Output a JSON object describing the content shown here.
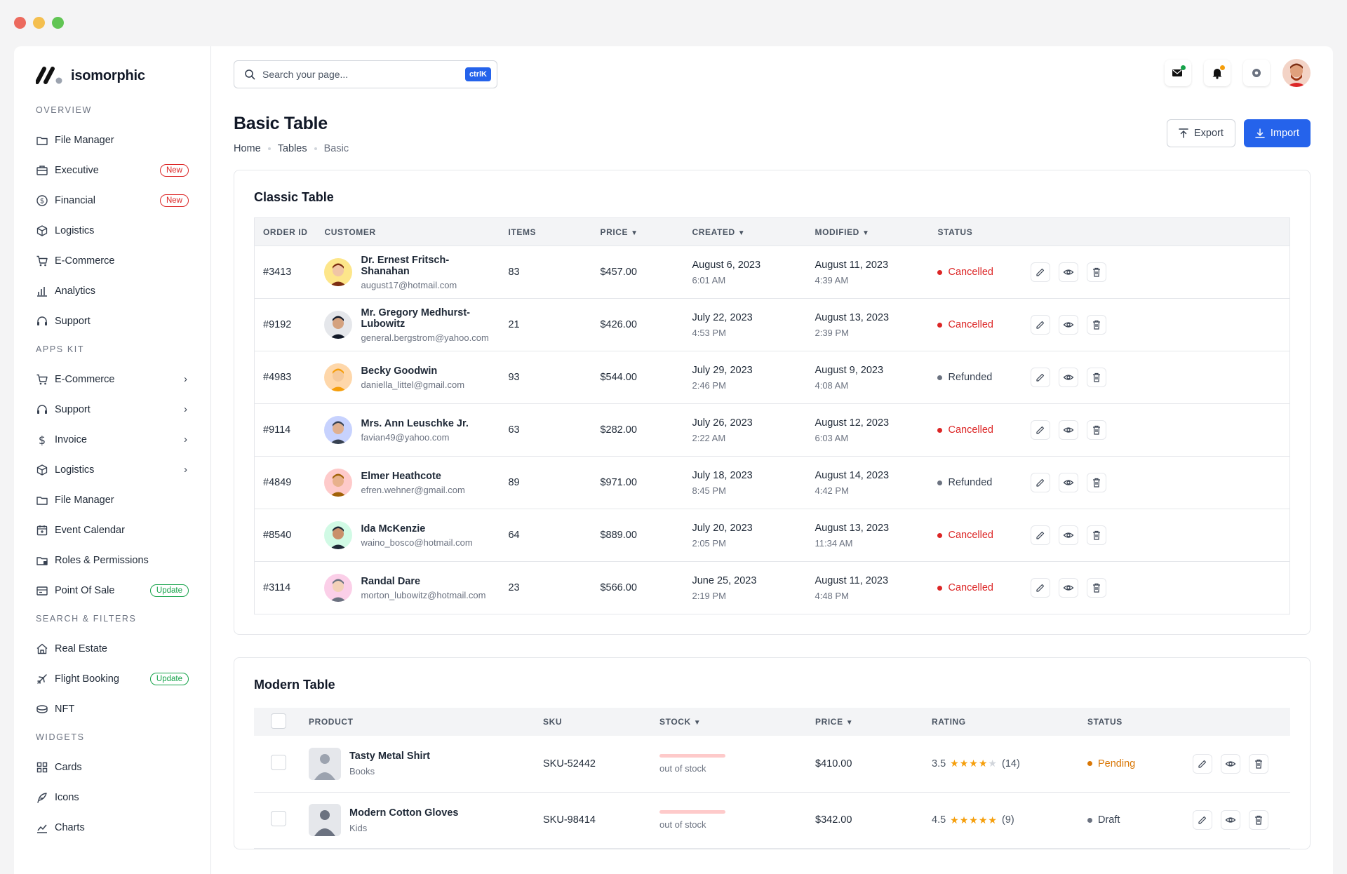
{
  "window_controls": {
    "colors": [
      "#ec6a5e",
      "#f4bf4f",
      "#61c554"
    ]
  },
  "brand": {
    "name": "isomorphic"
  },
  "sidebar": {
    "sections": [
      {
        "title": "OVERVIEW",
        "items": [
          {
            "label": "File Manager",
            "icon": "folder-icon"
          },
          {
            "label": "Executive",
            "icon": "briefcase-icon",
            "badge": "New",
            "badge_type": "new"
          },
          {
            "label": "Financial",
            "icon": "dollar-circle-icon",
            "badge": "New",
            "badge_type": "new"
          },
          {
            "label": "Logistics",
            "icon": "package-icon"
          },
          {
            "label": "E-Commerce",
            "icon": "cart-icon"
          },
          {
            "label": "Analytics",
            "icon": "bar-chart-icon"
          },
          {
            "label": "Support",
            "icon": "headset-icon"
          }
        ]
      },
      {
        "title": "APPS KIT",
        "items": [
          {
            "label": "E-Commerce",
            "icon": "cart-icon",
            "chevron": true
          },
          {
            "label": "Support",
            "icon": "headset-icon",
            "chevron": true
          },
          {
            "label": "Invoice",
            "icon": "dollar-icon",
            "chevron": true
          },
          {
            "label": "Logistics",
            "icon": "package-icon",
            "chevron": true
          },
          {
            "label": "File Manager",
            "icon": "folder-icon"
          },
          {
            "label": "Event Calendar",
            "icon": "calendar-icon"
          },
          {
            "label": "Roles & Permissions",
            "icon": "folder-lock-icon"
          },
          {
            "label": "Point Of Sale",
            "icon": "pos-icon",
            "badge": "Update",
            "badge_type": "upd"
          }
        ]
      },
      {
        "title": "SEARCH & FILTERS",
        "items": [
          {
            "label": "Real Estate",
            "icon": "house-icon"
          },
          {
            "label": "Flight Booking",
            "icon": "plane-icon",
            "badge": "Update",
            "badge_type": "upd"
          },
          {
            "label": "NFT",
            "icon": "coins-icon"
          }
        ]
      },
      {
        "title": "WIDGETS",
        "items": [
          {
            "label": "Cards",
            "icon": "grid-icon"
          },
          {
            "label": "Icons",
            "icon": "feather-icon"
          },
          {
            "label": "Charts",
            "icon": "line-chart-icon"
          }
        ]
      }
    ]
  },
  "search": {
    "placeholder": "Search your page...",
    "shortcut": "ctrlK"
  },
  "header": {
    "notification_dot_colors": [
      "#16a34a",
      "#f59e0b"
    ]
  },
  "page": {
    "title": "Basic Table",
    "breadcrumbs": [
      "Home",
      "Tables",
      "Basic"
    ],
    "export_label": "Export",
    "import_label": "Import"
  },
  "classic_table": {
    "title": "Classic Table",
    "columns": [
      "ORDER ID",
      "CUSTOMER",
      "ITEMS",
      "PRICE",
      "CREATED",
      "MODIFIED",
      "STATUS"
    ],
    "rows": [
      {
        "id": "#3413",
        "name": "Dr. Ernest Fritsch-Shanahan",
        "email": "august17@hotmail.com",
        "items": "83",
        "price": "$457.00",
        "created_date": "August 6, 2023",
        "created_time": "6:01 AM",
        "modified_date": "August 11, 2023",
        "modified_time": "4:39 AM",
        "status": "Cancelled"
      },
      {
        "id": "#9192",
        "name": "Mr. Gregory Medhurst-Lubowitz",
        "email": "general.bergstrom@yahoo.com",
        "items": "21",
        "price": "$426.00",
        "created_date": "July 22, 2023",
        "created_time": "4:53 PM",
        "modified_date": "August 13, 2023",
        "modified_time": "2:39 PM",
        "status": "Cancelled"
      },
      {
        "id": "#4983",
        "name": "Becky Goodwin",
        "email": "daniella_littel@gmail.com",
        "items": "93",
        "price": "$544.00",
        "created_date": "July 29, 2023",
        "created_time": "2:46 PM",
        "modified_date": "August 9, 2023",
        "modified_time": "4:08 AM",
        "status": "Refunded"
      },
      {
        "id": "#9114",
        "name": "Mrs. Ann Leuschke Jr.",
        "email": "favian49@yahoo.com",
        "items": "63",
        "price": "$282.00",
        "created_date": "July 26, 2023",
        "created_time": "2:22 AM",
        "modified_date": "August 12, 2023",
        "modified_time": "6:03 AM",
        "status": "Cancelled"
      },
      {
        "id": "#4849",
        "name": "Elmer Heathcote",
        "email": "efren.wehner@gmail.com",
        "items": "89",
        "price": "$971.00",
        "created_date": "July 18, 2023",
        "created_time": "8:45 PM",
        "modified_date": "August 14, 2023",
        "modified_time": "4:42 PM",
        "status": "Refunded"
      },
      {
        "id": "#8540",
        "name": "Ida McKenzie",
        "email": "waino_bosco@hotmail.com",
        "items": "64",
        "price": "$889.00",
        "created_date": "July 20, 2023",
        "created_time": "2:05 PM",
        "modified_date": "August 13, 2023",
        "modified_time": "11:34 AM",
        "status": "Cancelled"
      },
      {
        "id": "#3114",
        "name": "Randal Dare",
        "email": "morton_lubowitz@hotmail.com",
        "items": "23",
        "price": "$566.00",
        "created_date": "June 25, 2023",
        "created_time": "2:19 PM",
        "modified_date": "August 11, 2023",
        "modified_time": "4:48 PM",
        "status": "Cancelled"
      }
    ]
  },
  "modern_table": {
    "title": "Modern Table",
    "columns": [
      "PRODUCT",
      "SKU",
      "STOCK",
      "PRICE",
      "RATING",
      "STATUS"
    ],
    "rows": [
      {
        "name": "Tasty Metal Shirt",
        "category": "Books",
        "sku": "SKU-52442",
        "stock": "out of stock",
        "stock_level": 0,
        "price": "$410.00",
        "rating": "3.5",
        "rating_value": 3.5,
        "reviews": "(14)",
        "status": "Pending"
      },
      {
        "name": "Modern Cotton Gloves",
        "category": "Kids",
        "sku": "SKU-98414",
        "stock": "out of stock",
        "stock_level": 0,
        "price": "$342.00",
        "rating": "4.5",
        "rating_value": 4.5,
        "reviews": "(9)",
        "status": "Draft"
      }
    ]
  },
  "colors": {
    "primary": "#2563eb",
    "cancelled": "#dc2626",
    "refunded": "#6b7280",
    "pending": "#d97706",
    "draft": "#6b7280",
    "star": "#f59e0b"
  }
}
